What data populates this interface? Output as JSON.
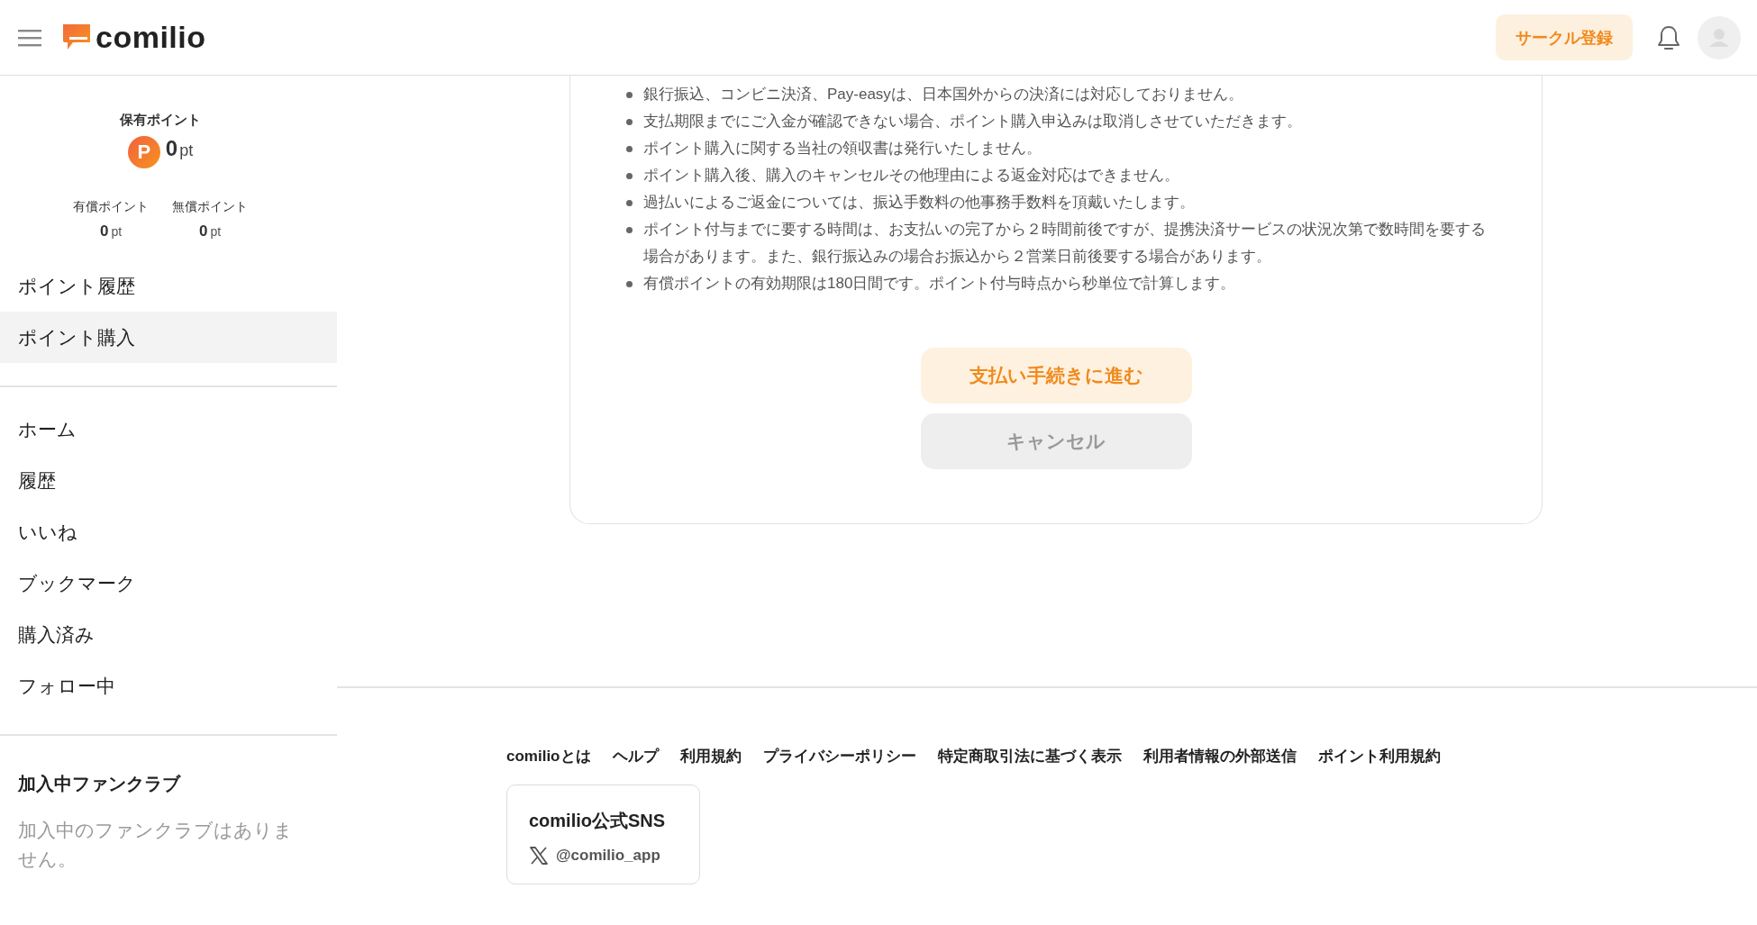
{
  "header": {
    "logo": "comilio",
    "register_button": "サークル登録"
  },
  "sidebar": {
    "points": {
      "label": "保有ポイント",
      "badge": "P",
      "value": "0",
      "unit": "pt"
    },
    "sub_points": [
      {
        "label": "有償ポイント",
        "value": "0",
        "unit": "pt"
      },
      {
        "label": "無償ポイント",
        "value": "0",
        "unit": "pt"
      }
    ],
    "point_menu": [
      {
        "label": "ポイント履歴",
        "selected": false
      },
      {
        "label": "ポイント購入",
        "selected": true
      }
    ],
    "nav": [
      {
        "label": "ホーム",
        "selected": false
      },
      {
        "label": "履歴",
        "selected": false
      },
      {
        "label": "いいね",
        "selected": false
      },
      {
        "label": "ブックマーク",
        "selected": false
      },
      {
        "label": "購入済み",
        "selected": false
      },
      {
        "label": "フォロー中",
        "selected": false
      }
    ],
    "fanclub": {
      "title": "加入中ファンクラブ",
      "empty_text": "加入中のファンクラブはありません。"
    }
  },
  "notes": [
    "銀行振込、コンビニ決済、Pay-easyは、日本国外からの決済には対応しておりません。",
    "支払期限までにご入金が確認できない場合、ポイント購入申込みは取消しさせていただきます。",
    "ポイント購入に関する当社の領収書は発行いたしません。",
    "ポイント購入後、購入のキャンセルその他理由による返金対応はできません。",
    "過払いによるご返金については、振込手数料の他事務手数料を頂戴いたします。",
    "ポイント付与までに要する時間は、お支払いの完了から２時間前後ですが、提携決済サービスの状況次第で数時間を要する場合があります。また、銀行振込みの場合お振込から２営業日前後要する場合があります。",
    "有償ポイントの有効期限は180日間です。ポイント付与時点から秒単位で計算します。"
  ],
  "buttons": {
    "proceed": "支払い手続きに進む",
    "cancel": "キャンセル"
  },
  "footer": {
    "links": [
      "comilioとは",
      "ヘルプ",
      "利用規約",
      "プライバシーポリシー",
      "特定商取引法に基づく表示",
      "利用者情報の外部送信",
      "ポイント利用規約"
    ],
    "sns": {
      "title": "comilio公式SNS",
      "handle": "@comilio_app"
    }
  }
}
